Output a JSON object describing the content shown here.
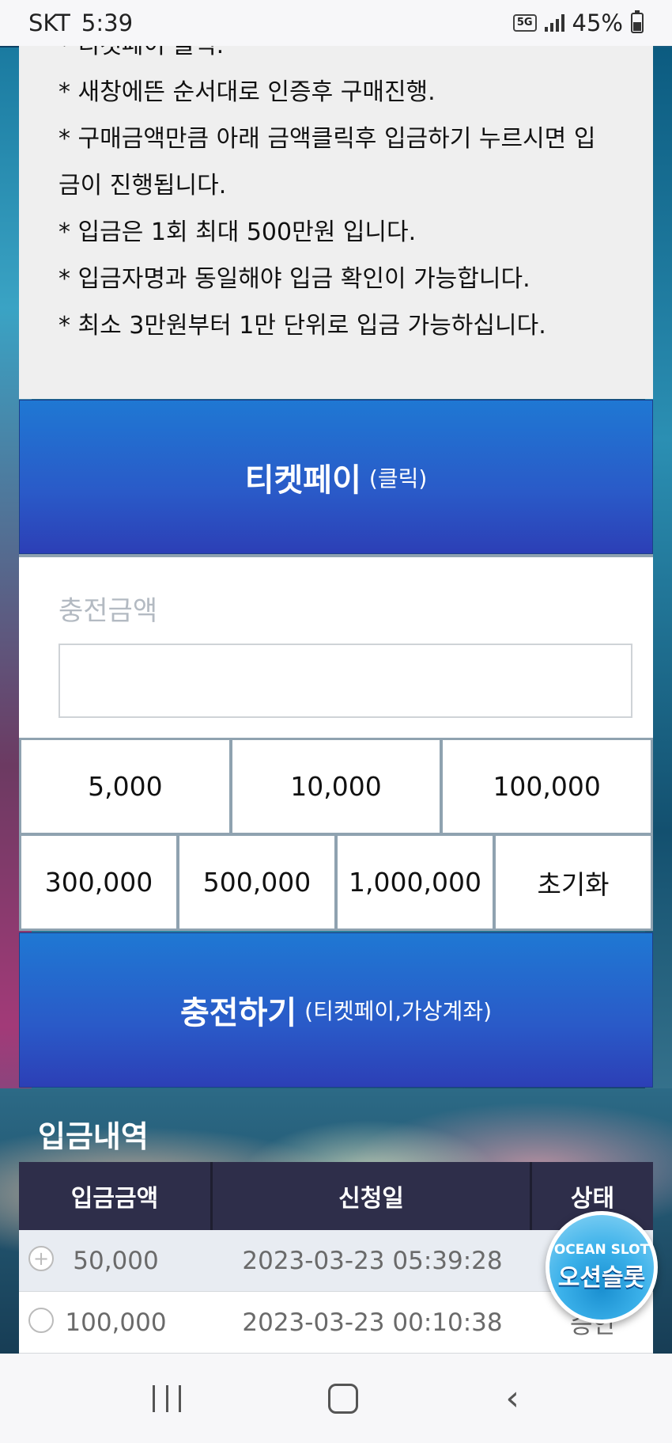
{
  "status_bar": {
    "carrier": "SKT",
    "time": "5:39",
    "network": "5G",
    "battery": "45%"
  },
  "notice": {
    "lines": [
      "* 티켓페이 클릭.",
      "* 새창에뜬 순서대로 인증후 구매진행.",
      "* 구매금액만큼 아래 금액클릭후 입금하기 누르시면 입",
      "금이 진행됩니다.",
      "* 입금은 1회 최대 500만원 입니다.",
      "* 입금자명과 동일해야 입금 확인이 가능합니다.",
      "* 최소 3만원부터 1만 단위로 입금 가능하십니다."
    ]
  },
  "ticketpay_button": {
    "label": "티켓페이",
    "sub": "(클릭)"
  },
  "amount": {
    "label": "충전금액",
    "value": ""
  },
  "amount_buttons": {
    "row1": [
      "5,000",
      "10,000",
      "100,000"
    ],
    "row2": [
      "300,000",
      "500,000",
      "1,000,000",
      "초기화"
    ]
  },
  "charge_button": {
    "label": "충전하기",
    "sub": "(티켓페이,가상계좌)"
  },
  "history": {
    "title": "입금내역",
    "columns": [
      "입금금액",
      "신청일",
      "상태"
    ],
    "rows": [
      {
        "amount": "50,000",
        "date": "2023-03-23 05:39:28",
        "status": ""
      },
      {
        "amount": "100,000",
        "date": "2023-03-23 00:10:38",
        "status": "승인"
      }
    ]
  },
  "logo": {
    "en": "OCEAN SLOT",
    "ko": "오션슬롯"
  }
}
